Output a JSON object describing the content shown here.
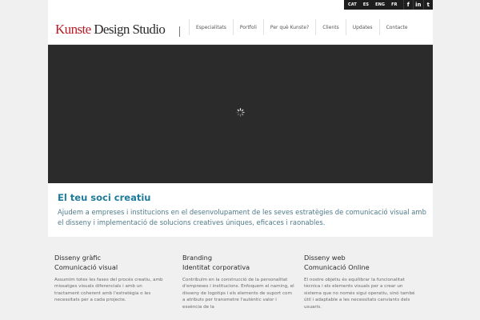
{
  "topbar": {
    "languages": [
      "CAT",
      "ES",
      "ENG",
      "FR"
    ],
    "social": [
      {
        "name": "facebook-icon",
        "glyph": "f"
      },
      {
        "name": "linkedin-icon",
        "glyph": "in"
      },
      {
        "name": "twitter-icon",
        "glyph": "t"
      }
    ]
  },
  "header": {
    "logo_part1": "Kunste",
    "logo_part2": "Design",
    "logo_part3": "Studio",
    "nav": [
      "Especialitats",
      "Portfoli",
      "Per què Kunste?",
      "Clients",
      "Updates",
      "Contacte"
    ]
  },
  "intro": {
    "title": "El teu soci creatiu",
    "text": "Ajudem a empreses i institucions en el desenvolupament de les seves estratègies de comunicació visual amb el disseny i implementació de solucions creatives úniques, eficaces i raonables."
  },
  "columns": [
    {
      "title_line1": "Disseny gràfic",
      "title_line2": "Comunicació visual",
      "text": "Assumim totes les fases del procés creatiu, amb missatges visuals diferencials i amb un tractament coherent amb l'estratègia o les necessitats per a cada projecte."
    },
    {
      "title_line1": "Branding",
      "title_line2": "Identitat corporativa",
      "text": "Contribuïm en la construcció de la personalitat d'empreses i institucions. Enfoquem el naming, el disseny de logotips i els elements de suport com a atributs per transmetre l'autèntic valor i essència de la"
    },
    {
      "title_line1": "Disseny web",
      "title_line2": "Comunicació Online",
      "text": "El nostre objetiu és equilibrar la funcionalitat tècnica i els elements visuals per a crear un sistema que no només sigui operatiu, sinó també útil i adaptable a les necessitats canviants dels usuaris."
    }
  ],
  "colors": {
    "brand_red": "#b71b25",
    "accent_blue": "#1e7b9c",
    "slider_bg": "#2b2b2b",
    "topbar_dark": "#1e1e1e"
  }
}
